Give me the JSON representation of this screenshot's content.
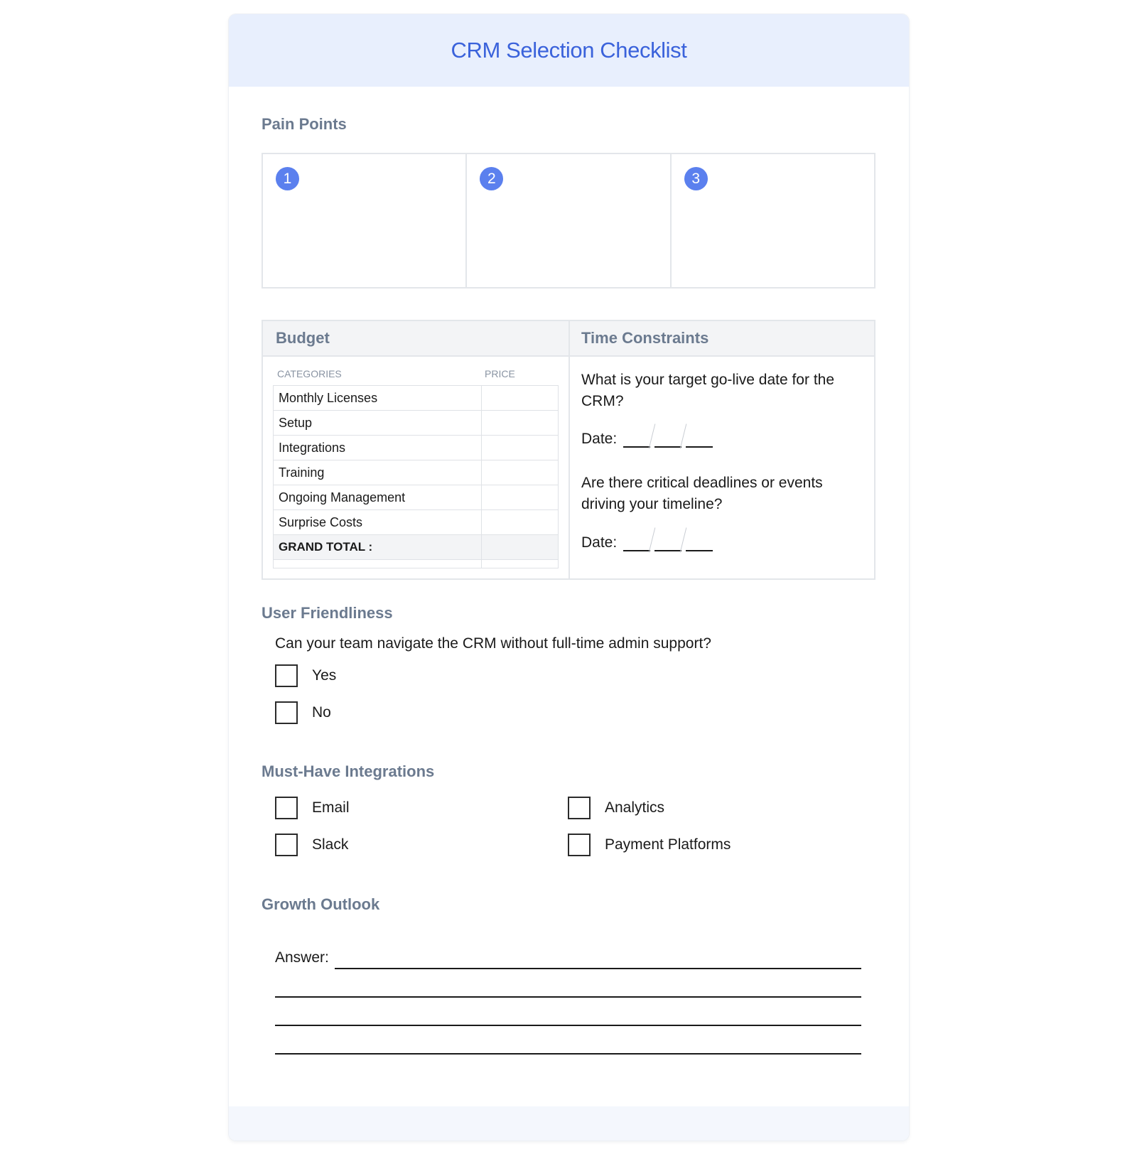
{
  "header": {
    "title": "CRM Selection Checklist"
  },
  "pain_points": {
    "title": "Pain Points",
    "items": [
      "1",
      "2",
      "3"
    ]
  },
  "budget": {
    "title": "Budget",
    "col_categories": "CATEGORIES",
    "col_price": "PRICE",
    "rows": [
      "Monthly Licenses",
      "Setup",
      "Integrations",
      "Training",
      "Ongoing Management",
      "Surprise Costs"
    ],
    "total_label": "GRAND TOTAL :"
  },
  "time_constraints": {
    "title": "Time Constraints",
    "question1": "What is your target go-live date for the CRM?",
    "question2": "Are there critical deadlines or events driving your timeline?",
    "date_label": "Date:"
  },
  "user_friendliness": {
    "title": "User Friendliness",
    "question": "Can your team navigate the CRM without full-time admin support?",
    "options": [
      "Yes",
      "No"
    ]
  },
  "integrations": {
    "title": "Must-Have Integrations",
    "options": [
      "Email",
      "Slack",
      "Analytics",
      "Payment Platforms"
    ]
  },
  "growth": {
    "title": "Growth Outlook",
    "answer_label": "Answer:"
  },
  "colors": {
    "accent": "#3a62db",
    "badge": "#5b80ee",
    "header_bg": "#e8effd",
    "section_title": "#6b7a8f"
  }
}
